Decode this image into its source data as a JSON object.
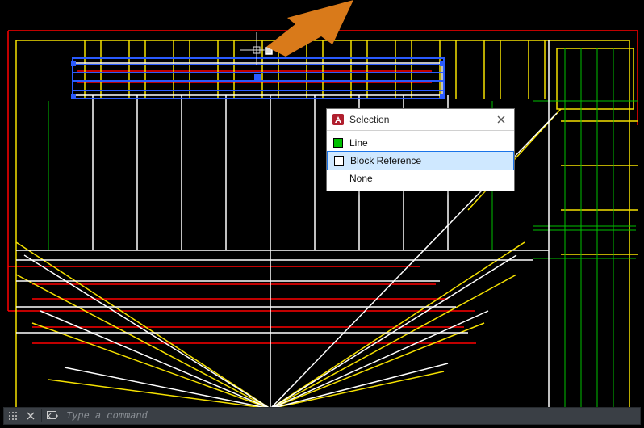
{
  "popup": {
    "title": "Selection",
    "items": [
      {
        "label": "Line",
        "swatch": "green",
        "highlight": false
      },
      {
        "label": "Block Reference",
        "swatch": "white",
        "highlight": true
      },
      {
        "label": "None",
        "swatch": "none",
        "highlight": false
      }
    ]
  },
  "commandline": {
    "placeholder": "Type a command"
  },
  "annotation": {
    "kind": "arrow",
    "color": "#d97a1a"
  }
}
